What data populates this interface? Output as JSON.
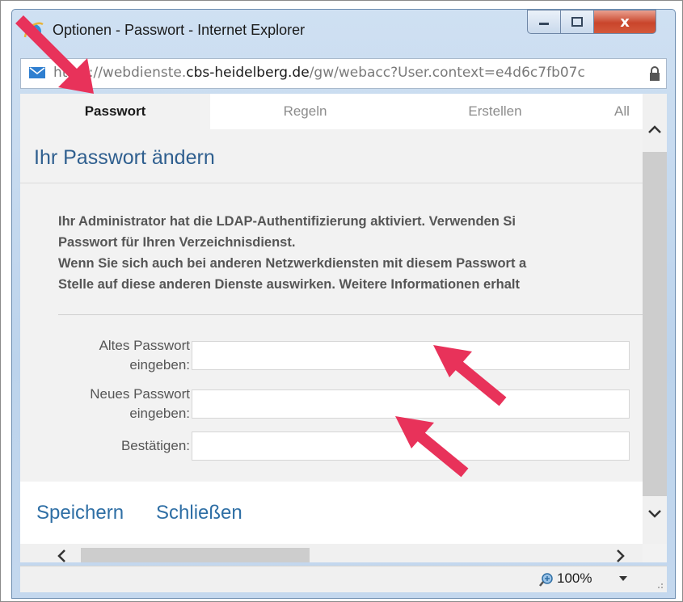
{
  "window": {
    "title": "Optionen - Passwort - Internet Explorer",
    "close_label": "x"
  },
  "address": {
    "url_prefix": "https://webdienste.",
    "url_domain": "cbs-heidelberg.de",
    "url_suffix": "/gw/webacc?User.context=e4d6c7fb07c"
  },
  "tabs": [
    {
      "label": "Passwort",
      "active": true
    },
    {
      "label": "Regeln",
      "active": false
    },
    {
      "label": "Erstellen",
      "active": false
    },
    {
      "label": "All",
      "active": false
    }
  ],
  "page": {
    "heading": "Ihr Passwort ändern",
    "info_lines": [
      "Ihr Administrator hat die LDAP-Authentifizierung aktiviert. Verwenden Si",
      "Passwort für Ihren Verzeichnisdienst.",
      "Wenn Sie sich auch bei anderen Netzwerkdiensten mit diesem Passwort a",
      "Stelle auf diese anderen Dienste auswirken. Weitere Informationen erhalt"
    ],
    "fields": {
      "old_line1": "Altes Passwort",
      "old_line2": "eingeben:",
      "new_line1": "Neues Passwort",
      "new_line2": "eingeben:",
      "confirm": "Bestätigen:",
      "old_value": "",
      "new_value": "",
      "confirm_value": ""
    },
    "save_label": "Speichern",
    "close_label": "Schließen"
  },
  "status": {
    "zoom": "100%"
  },
  "colors": {
    "annotation_arrow": "#e8325a",
    "link": "#2f6fa5",
    "heading": "#2f5f8f"
  },
  "icons": [
    "ie-logo-icon",
    "minimize-icon",
    "maximize-icon",
    "close-icon",
    "mail-icon",
    "lock-icon",
    "zoom-icon",
    "chevron-up-icon",
    "chevron-down-icon",
    "chevron-left-icon",
    "chevron-right-icon"
  ]
}
